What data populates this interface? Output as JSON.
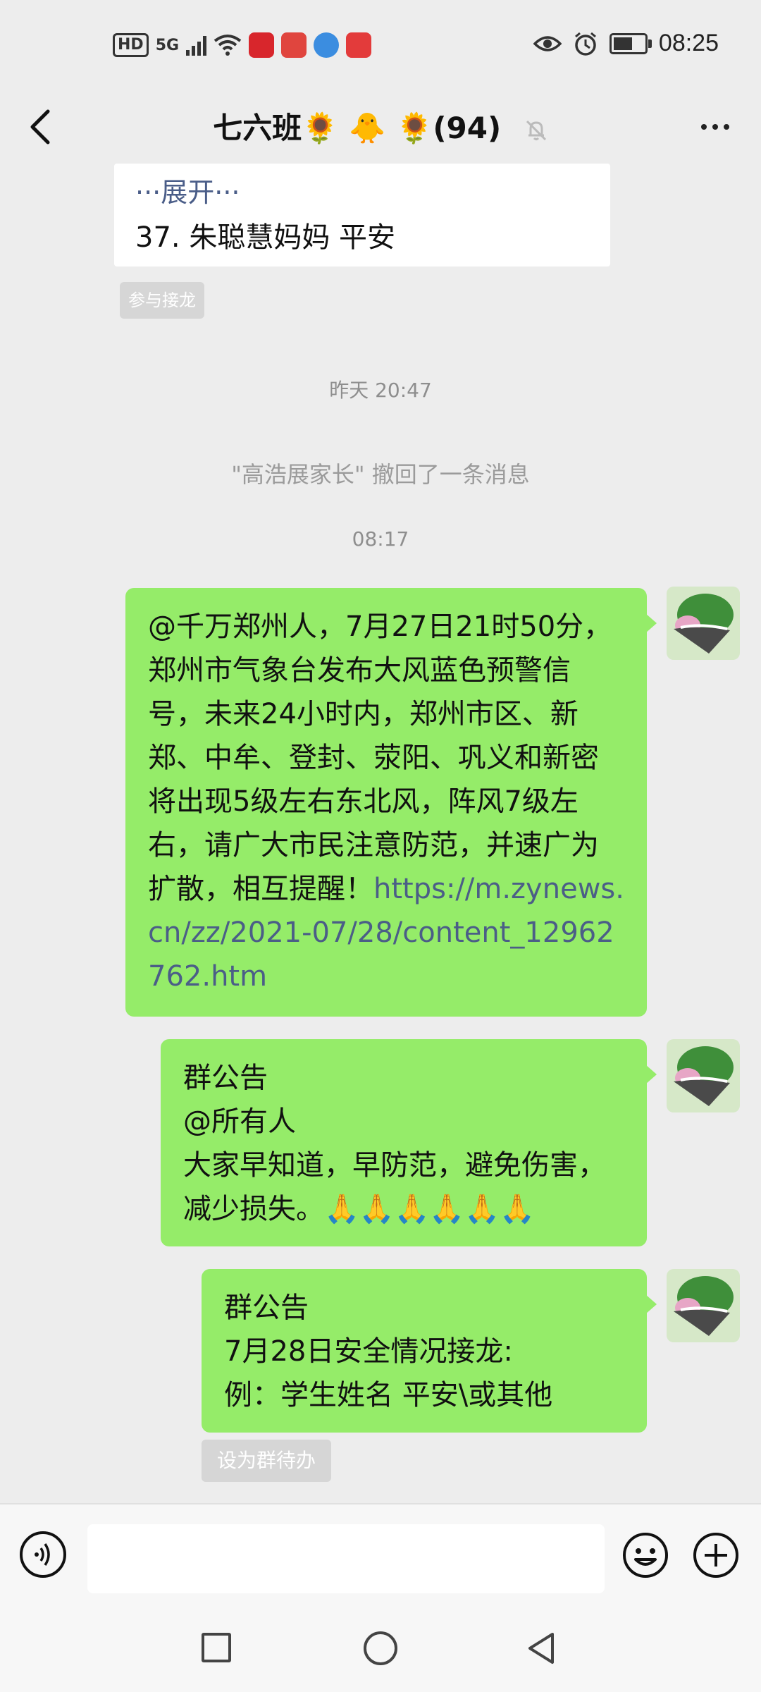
{
  "status_bar": {
    "hd": "HD",
    "network": "5G",
    "time": "08:25",
    "icons": [
      "eye-icon",
      "alarm-icon",
      "battery-icon"
    ]
  },
  "header": {
    "title": "七六班🌻 🐥 🌻(94)",
    "mute_icon": "bell-off-icon"
  },
  "chat": {
    "solitaire_card": {
      "expand_text": "···展开···",
      "last_entry": "37. 朱聪慧妈妈 平安"
    },
    "join_button": "参与接龙",
    "time_1": "昨天 20:47",
    "recall_notice": "\"高浩展家长\" 撤回了一条消息",
    "time_2": "08:17",
    "messages": [
      {
        "text": "@千万郑州人，7月27日21时50分，郑州市气象台发布大风蓝色预警信号，未来24小时内，郑州市区、新郑、中牟、登封、荥阳、巩义和新密将出现5级左右东北风，阵风7级左右，请广大市民注意防范，并速广为扩散，相互提醒！",
        "link": "https://m.zynews.cn/zz/2021-07/28/content_12962762.htm"
      },
      {
        "line1": "群公告",
        "line2": "@所有人",
        "line3": "大家早知道，早防范，避免伤害，减少损失。🙏🙏🙏🙏🙏🙏"
      },
      {
        "line1": "群公告",
        "line2": "7月28日安全情况接龙:",
        "line3": "例：学生姓名     平安\\或其他"
      }
    ],
    "todo_button": "设为群待办"
  },
  "input_bar": {
    "placeholder": ""
  },
  "colors": {
    "bubble": "#95ec69",
    "background": "#ededed",
    "link": "#4b5e87"
  }
}
